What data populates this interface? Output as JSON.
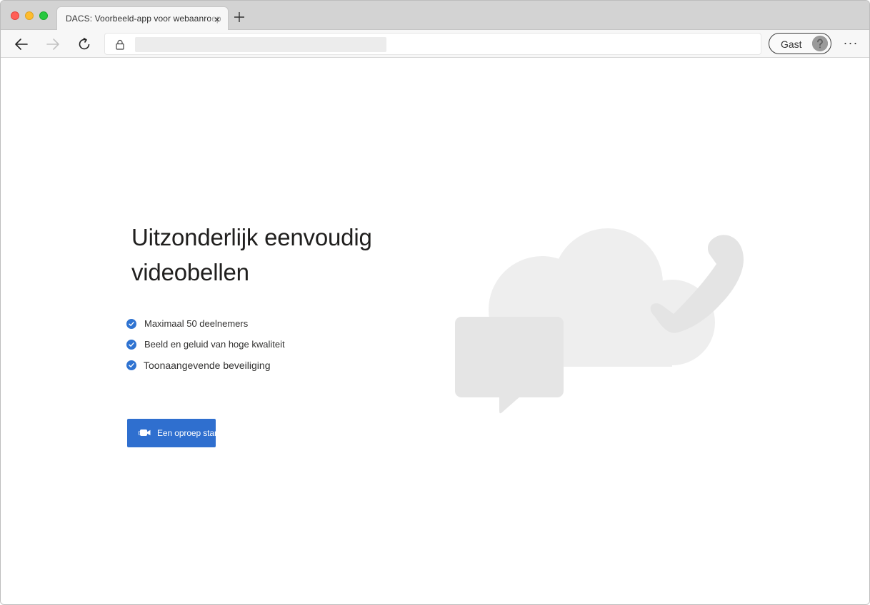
{
  "browser": {
    "tab_title": "DACS:  Voorbeeld-app  voor  webaanroep",
    "tab_close_glyph": "×",
    "url": "",
    "profile_label": "Gast",
    "menu_glyph": "···",
    "icons": [
      "back-arrow-icon",
      "forward-arrow-icon",
      "reload-icon",
      "lock-icon",
      "new-tab-plus-icon",
      "guest-avatar-icon",
      "more-options-icon"
    ]
  },
  "hero": {
    "headline_line1": "Uitzonderlijk eenvoudig",
    "headline_line2": "videobellen",
    "features": [
      "Maximaal 50 deelnemers",
      "Beeld en geluid van hoge kwaliteit",
      "Toonaangevende beveiliging"
    ],
    "cta_label": "Een oproep starten"
  },
  "colors": {
    "accent": "#2f6fcf",
    "check": "#2f73d1",
    "illustration": "#e6e6e6",
    "illustration_light": "#eeeeee"
  }
}
